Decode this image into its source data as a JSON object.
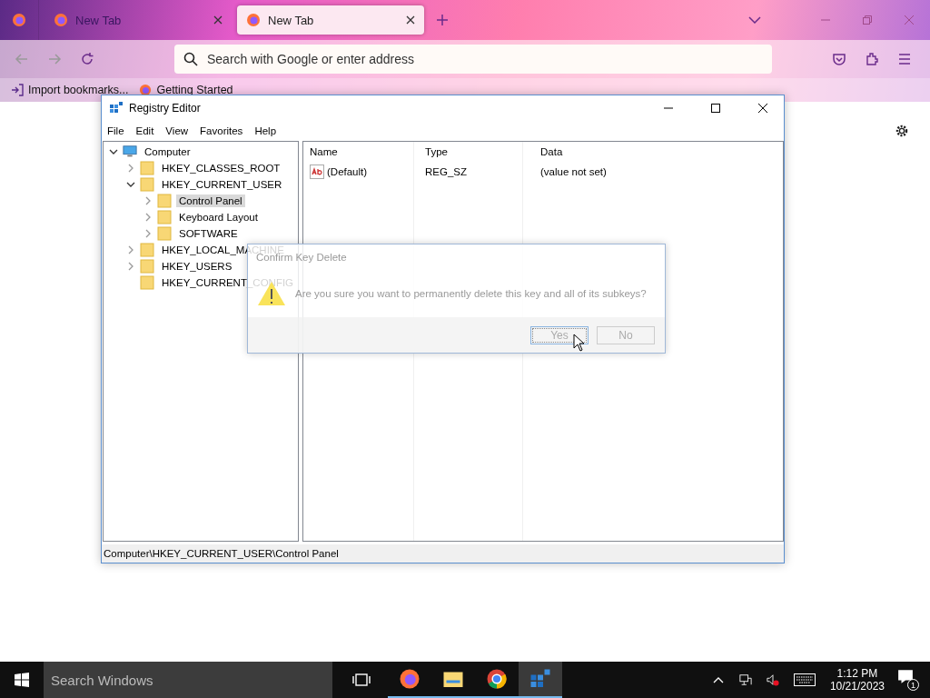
{
  "browser": {
    "tabs": [
      {
        "label": "New Tab",
        "selected": false
      },
      {
        "label": "New Tab",
        "selected": true
      }
    ],
    "address": {
      "placeholder": "Search with Google or enter address"
    },
    "bookmarks": [
      "Import bookmarks...",
      "Getting Started"
    ]
  },
  "registry_editor": {
    "title": "Registry Editor",
    "menu": [
      "File",
      "Edit",
      "View",
      "Favorites",
      "Help"
    ],
    "tree": [
      {
        "label": "Computer",
        "expanded": true,
        "has_children": true,
        "selected": false,
        "children": [
          {
            "label": "HKEY_CLASSES_ROOT",
            "expanded": false,
            "has_children": true,
            "selected": false
          },
          {
            "label": "HKEY_CURRENT_USER",
            "expanded": true,
            "has_children": true,
            "selected": false,
            "children": [
              {
                "label": "Control Panel",
                "expanded": false,
                "has_children": true,
                "selected": true
              },
              {
                "label": "Keyboard Layout",
                "expanded": false,
                "has_children": true,
                "selected": false
              },
              {
                "label": "SOFTWARE",
                "expanded": false,
                "has_children": true,
                "selected": false
              }
            ]
          },
          {
            "label": "HKEY_LOCAL_MACHINE",
            "expanded": false,
            "has_children": true,
            "selected": false
          },
          {
            "label": "HKEY_USERS",
            "expanded": false,
            "has_children": true,
            "selected": false
          },
          {
            "label": "HKEY_CURRENT_CONFIG",
            "expanded": false,
            "has_children": false,
            "selected": false
          }
        ]
      }
    ],
    "columns": [
      "Name",
      "Type",
      "Data"
    ],
    "rows": [
      {
        "name": "(Default)",
        "type": "REG_SZ",
        "data": "(value not set)"
      }
    ],
    "status_bar": "Computer\\HKEY_CURRENT_USER\\Control Panel"
  },
  "dialog": {
    "title": "Confirm Key Delete",
    "message": "Are you sure you want to permanently delete this key and all of its subkeys?",
    "buttons": [
      {
        "label": "Yes",
        "focused": true
      },
      {
        "label": "No",
        "focused": false
      }
    ]
  },
  "taskbar": {
    "search": {
      "placeholder": "Search Windows"
    },
    "apps": [
      {
        "kind": "firefox",
        "selected": false
      },
      {
        "kind": "explorer",
        "selected": false
      },
      {
        "kind": "chrome",
        "selected": false
      },
      {
        "kind": "regedit",
        "selected": true
      }
    ],
    "time": "1:12 PM",
    "date": "10/21/2023",
    "notifications": "1"
  }
}
